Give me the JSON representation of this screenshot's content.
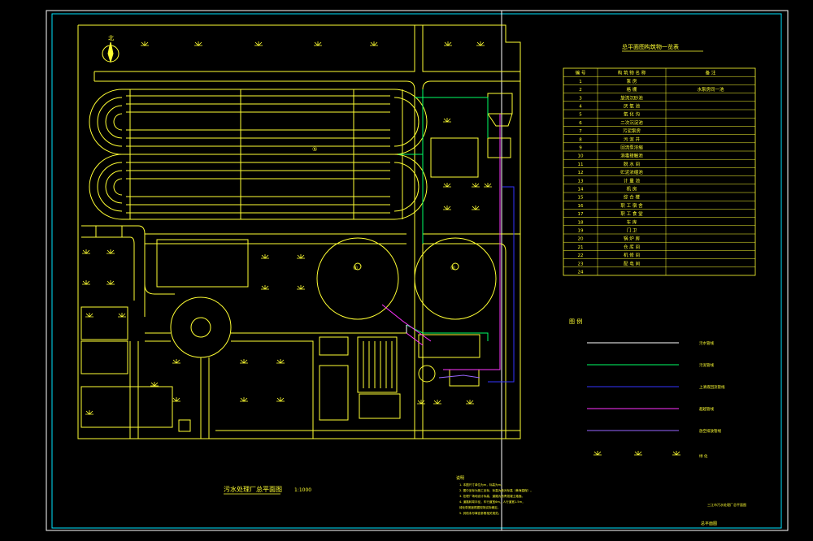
{
  "colors": {
    "background": "#000000",
    "frame": "#ffffff",
    "inner_frame": "#00e5ff",
    "drawing": "#ffff33",
    "road": "#ffff33",
    "pipe_green": "#00ff66",
    "pipe_blue": "#3333ff",
    "pipe_magenta": "#ff33ff",
    "pipe_violet": "#9966ff",
    "pipe_white": "#ffffff"
  },
  "north_label": "北",
  "table": {
    "title": "总平面图构筑物一览表",
    "headers": [
      "编 号",
      "构 筑 物 名 称",
      "备 注"
    ],
    "rows": [
      {
        "no": "1",
        "name": "泵 房",
        "note": ""
      },
      {
        "no": "2",
        "name": "格 栅",
        "note": "水泵房同一池"
      },
      {
        "no": "3",
        "name": "旋流沉砂池",
        "note": ""
      },
      {
        "no": "4",
        "name": "厌 氧 池",
        "note": ""
      },
      {
        "no": "5",
        "name": "氧 化 沟",
        "note": ""
      },
      {
        "no": "6",
        "name": "二次沉淀池",
        "note": ""
      },
      {
        "no": "7",
        "name": "污泥泵房",
        "note": ""
      },
      {
        "no": "8",
        "name": "污 泥 井",
        "note": ""
      },
      {
        "no": "9",
        "name": "回流泵浓缩",
        "note": ""
      },
      {
        "no": "10",
        "name": "消毒接触池",
        "note": ""
      },
      {
        "no": "11",
        "name": "脱 水 间",
        "note": ""
      },
      {
        "no": "12",
        "name": "贮泥浓缩池",
        "note": ""
      },
      {
        "no": "13",
        "name": "计 量 池",
        "note": ""
      },
      {
        "no": "14",
        "name": "机 房",
        "note": ""
      },
      {
        "no": "15",
        "name": "综 合 楼",
        "note": ""
      },
      {
        "no": "16",
        "name": "职 工 宿 舍",
        "note": ""
      },
      {
        "no": "17",
        "name": "职 工 食 堂",
        "note": ""
      },
      {
        "no": "18",
        "name": "车 库",
        "note": ""
      },
      {
        "no": "19",
        "name": "门 卫",
        "note": ""
      },
      {
        "no": "20",
        "name": "锅 炉 房",
        "note": ""
      },
      {
        "no": "21",
        "name": "仓 库 间",
        "note": ""
      },
      {
        "no": "22",
        "name": "机 修 间",
        "note": ""
      },
      {
        "no": "23",
        "name": "配 电 间",
        "note": ""
      },
      {
        "no": "24",
        "name": "",
        "note": ""
      }
    ]
  },
  "legend": {
    "title": "图 例",
    "items": [
      {
        "label": "污水管线",
        "color": "#ffffff"
      },
      {
        "label": "污泥管线",
        "color": "#00ff66"
      },
      {
        "label": "上清液回流管线",
        "color": "#3333ff"
      },
      {
        "label": "超越管线",
        "color": "#ff33ff"
      },
      {
        "label": "放空排放管线",
        "color": "#9966ff"
      }
    ],
    "grass_label": "绿 化"
  },
  "plan": {
    "title": "污水处理厂总平面图",
    "scale": "1:1000",
    "labels": {
      "oxidation_ditch": "⑤",
      "settling_1": "⑥",
      "settling_2": "⑥"
    }
  },
  "notes": {
    "heading": "说明",
    "lines": [
      "1. 本图尺寸单位为m，标高为m。",
      "2. 图中坐标为施工坐标，标高为绝对标高（黄海高程）。",
      "3. 处理厂场地设计标高，道路为沥青混凝土路面。",
      "4. 道路转弯半径，车行道宽6m，人行道宽1.5m，",
      "   绿化带宽度根据现场实际确定。",
      "5. 其他未尽事宜参照相关规范。"
    ]
  },
  "title_block": {
    "line1": "三江市污水处理厂总平面图",
    "line2": "总平面图"
  }
}
